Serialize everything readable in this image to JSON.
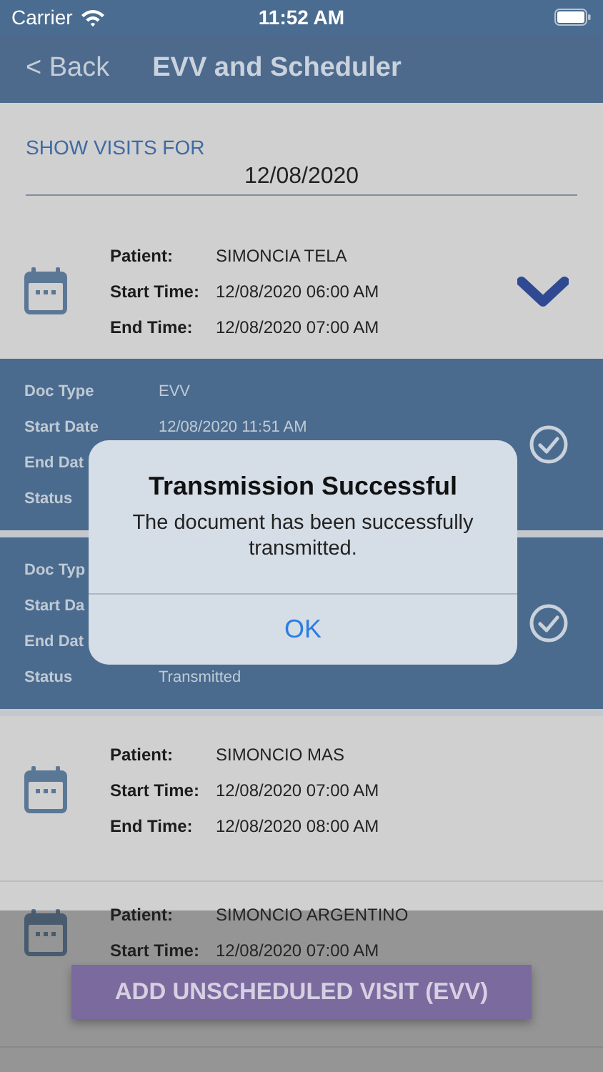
{
  "status_bar": {
    "carrier": "Carrier",
    "time": "11:52 AM"
  },
  "nav": {
    "back": "< Back",
    "title": "EVV and Scheduler"
  },
  "filter": {
    "label": "SHOW VISITS FOR",
    "date": "12/08/2020"
  },
  "items": [
    {
      "kind": "visit",
      "expanded": true,
      "fields": [
        {
          "label": "Patient:",
          "value": "SIMONCIA TELA"
        },
        {
          "label": "Start Time:",
          "value": "12/08/2020 06:00 AM"
        },
        {
          "label": "End Time:",
          "value": "12/08/2020 07:00 AM"
        }
      ]
    },
    {
      "kind": "document",
      "fields": [
        {
          "label": "Doc Type",
          "value": "EVV"
        },
        {
          "label": "Start Date",
          "value": "12/08/2020 11:51 AM"
        },
        {
          "label": "End Dat"
        },
        {
          "label": "Status"
        }
      ]
    },
    {
      "kind": "document",
      "fields": [
        {
          "label": "Doc Typ"
        },
        {
          "label": "Start Da"
        },
        {
          "label": "End Dat"
        },
        {
          "label": "Status",
          "value": "Transmitted"
        }
      ]
    },
    {
      "kind": "visit",
      "expanded": false,
      "fields": [
        {
          "label": "Patient:",
          "value": "SIMONCIO MAS"
        },
        {
          "label": "Start Time:",
          "value": "12/08/2020 07:00 AM"
        },
        {
          "label": "End Time:",
          "value": "12/08/2020 08:00 AM"
        }
      ]
    },
    {
      "kind": "visit",
      "expanded": false,
      "fields": [
        {
          "label": "Patient:",
          "value": "SIMONCIO ARGENTINO"
        },
        {
          "label": "Start Time:",
          "value": "12/08/2020 07:00 AM"
        }
      ]
    }
  ],
  "add_button": "ADD UNSCHEDULED VISIT (EVV)",
  "alert": {
    "title": "Transmission Successful",
    "message": "The document has been successfully transmitted.",
    "button": "OK"
  }
}
